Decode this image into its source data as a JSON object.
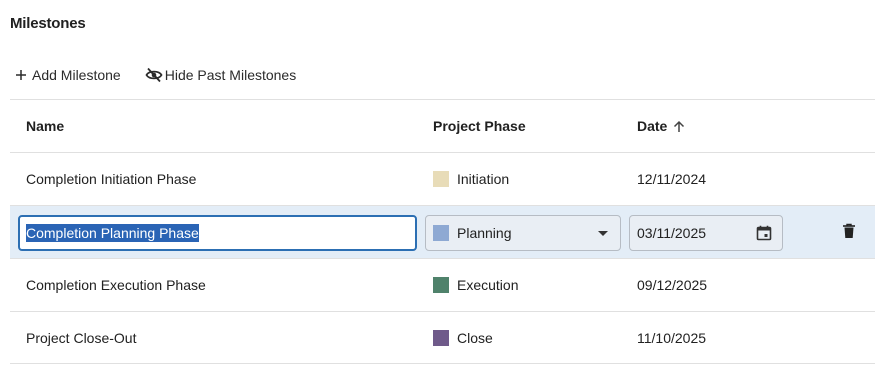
{
  "title": "Milestones",
  "toolbar": {
    "add_label": "Add Milestone",
    "hide_label": "Hide Past Milestones"
  },
  "columns": {
    "name": "Name",
    "phase": "Project Phase",
    "date": "Date",
    "date_sort": "ascending"
  },
  "rows": [
    {
      "name": "Completion Initiation Phase",
      "phase": "Initiation",
      "phase_color": "#e8dcb8",
      "date": "12/11/2024"
    },
    {
      "name": "Completion Planning Phase",
      "phase": "Planning",
      "phase_color": "#8ea9d3",
      "date": "03/11/2025",
      "editing": true
    },
    {
      "name": "Completion Execution Phase",
      "phase": "Execution",
      "phase_color": "#4f826b",
      "date": "09/12/2025"
    },
    {
      "name": "Project Close-Out",
      "phase": "Close",
      "phase_color": "#6f5a8a",
      "date": "11/10/2025"
    }
  ],
  "icons": {
    "add": "plus-icon",
    "hide": "eye-off-icon",
    "sort": "arrow-up-icon",
    "calendar": "calendar-icon",
    "delete": "trash-icon",
    "dropdown": "chevron-down-icon"
  },
  "colors": {
    "selected_row": "#e3edf7",
    "focus_border": "#2c6fb3",
    "text_selection": "#2a64b5"
  }
}
